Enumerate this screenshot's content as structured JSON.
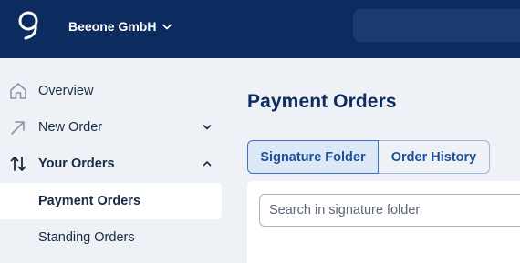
{
  "header": {
    "company_name": "Beeone GmbH",
    "logo_icon": "beeone-logo",
    "company_dropdown_icon": "chevron-down-icon",
    "bg_color": "#0c2b5e"
  },
  "sidebar": {
    "items": [
      {
        "label": "Overview",
        "icon": "home-icon"
      },
      {
        "label": "New Order",
        "icon": "arrow-up-right-icon",
        "chevron": "chevron-down-icon"
      },
      {
        "label": "Your Orders",
        "icon": "swap-arrows-icon",
        "chevron": "chevron-up-icon",
        "expanded": true
      }
    ],
    "sub_items": [
      {
        "label": "Payment Orders",
        "active": true
      },
      {
        "label": "Standing Orders",
        "active": false
      }
    ]
  },
  "main": {
    "title": "Payment Orders",
    "tabs": [
      {
        "label": "Signature Folder",
        "selected": true
      },
      {
        "label": "Order History",
        "selected": false
      }
    ],
    "search_placeholder": "Search in signature folder"
  },
  "colors": {
    "accent": "#1e4f9a",
    "title": "#0c2b5e",
    "page_bg": "#eef1f6"
  }
}
